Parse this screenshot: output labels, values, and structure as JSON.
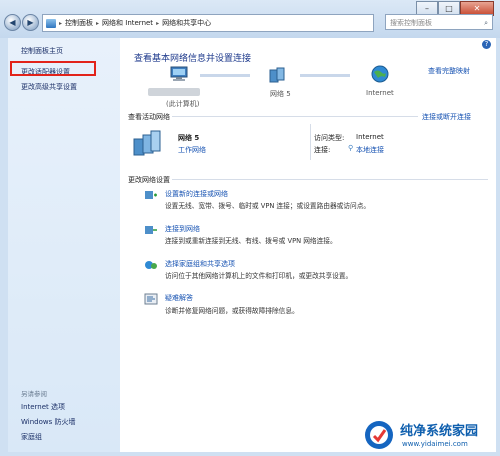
{
  "address_bar": {
    "segments": [
      "控制面板",
      "网络和 Internet",
      "网络和共享中心"
    ],
    "search_placeholder": "搜索控制面板"
  },
  "sidebar": {
    "top_links": [
      "控制面板主页",
      "更改适配器设置",
      "更改高级共享设置"
    ],
    "see_also_heading": "另请参阅",
    "see_also_links": [
      "Internet 选项",
      "Windows 防火墙",
      "家庭组"
    ]
  },
  "main": {
    "heading": "查看基本网络信息并设置连接",
    "view_full_map": "查看完整映射",
    "map": {
      "computer_label": "(此计算机)",
      "network_label": "网络  5",
      "internet_label": "Internet"
    },
    "active_networks": {
      "title": "查看活动网络",
      "connect_link": "连接或断开连接",
      "network_name": "网络  5",
      "network_type": "工作网络",
      "access_type_label": "访问类型:",
      "access_type_value": "Internet",
      "connection_label": "连接:",
      "connection_value": "本地连接"
    },
    "change_settings": {
      "title": "更改网络设置",
      "tasks": [
        {
          "title": "设置新的连接或网络",
          "desc": "设置无线、宽带、拨号、临时或 VPN 连接；或设置路由器或访问点。"
        },
        {
          "title": "连接到网络",
          "desc": "连接到或重新连接到无线、有线、拨号或 VPN 网络连接。"
        },
        {
          "title": "选择家庭组和共享选项",
          "desc": "访问位于其他网络计算机上的文件和打印机，或更改共享设置。"
        },
        {
          "title": "疑难解答",
          "desc": "诊断并修复网络问题，或获得故障排除信息。"
        }
      ]
    }
  },
  "watermark": {
    "title": "纯净系统家园",
    "url": "www.yidaimei.com"
  }
}
